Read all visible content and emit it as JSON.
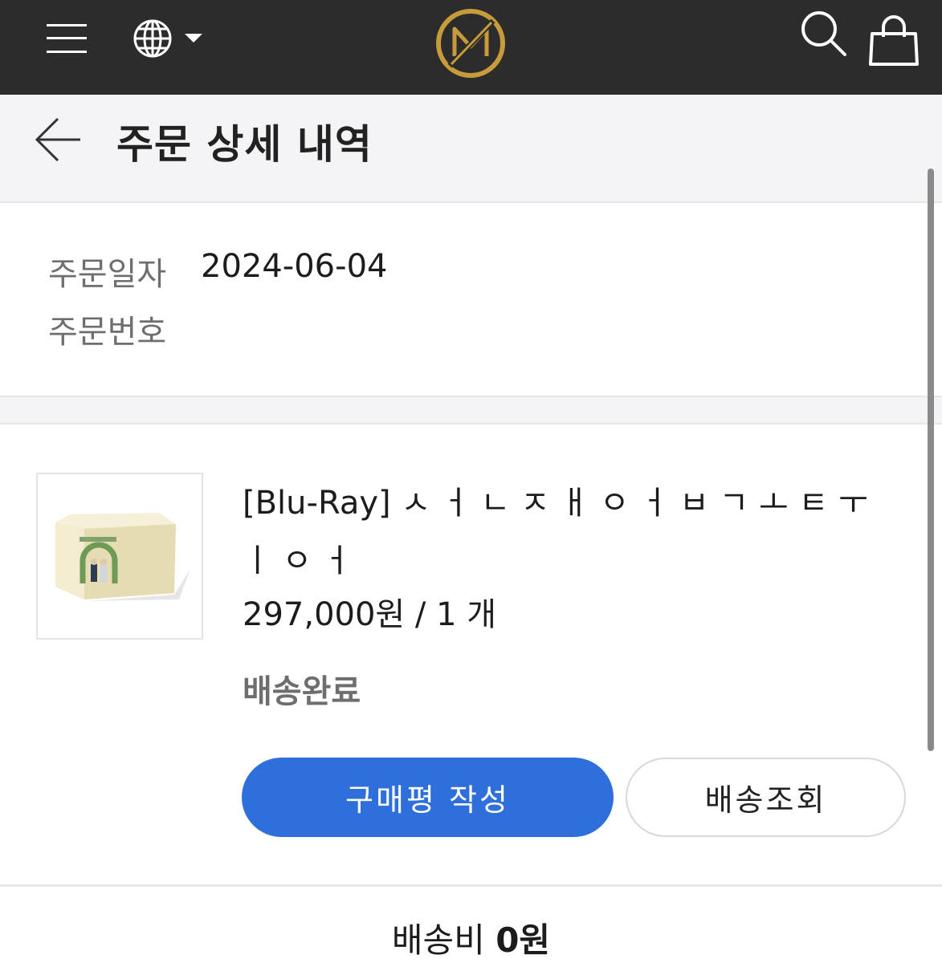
{
  "nav": {
    "icons": [
      "menu-icon",
      "globe-icon",
      "chevron-down-icon",
      "brand-logo",
      "search-icon",
      "shopping-bag-icon"
    ],
    "logo_color": "#c79a3a"
  },
  "header": {
    "title": "주문 상세 내역"
  },
  "order_info": {
    "date_label": "주문일자",
    "date_value": "2024-06-04",
    "number_label": "주문번호"
  },
  "product": {
    "name": "[Blu-Ray] ㅅ ㅓ ㄴ ㅈ ㅐ ㅇ ㅓ ㅂ ㄱ ㅗ ㅌ ㅜ ㅣ ㅇ ㅓ",
    "price": "297,000원 / 1 개",
    "status": "배송완료",
    "review_button": "구매평 작성",
    "track_button": "배송조회"
  },
  "summary": {
    "shipping_label": "배송비",
    "shipping_value": "0원"
  },
  "colors": {
    "topbar": "#2c2c2c",
    "primary_button": "#2f6fdb",
    "header_bg": "#f4f4f6"
  }
}
